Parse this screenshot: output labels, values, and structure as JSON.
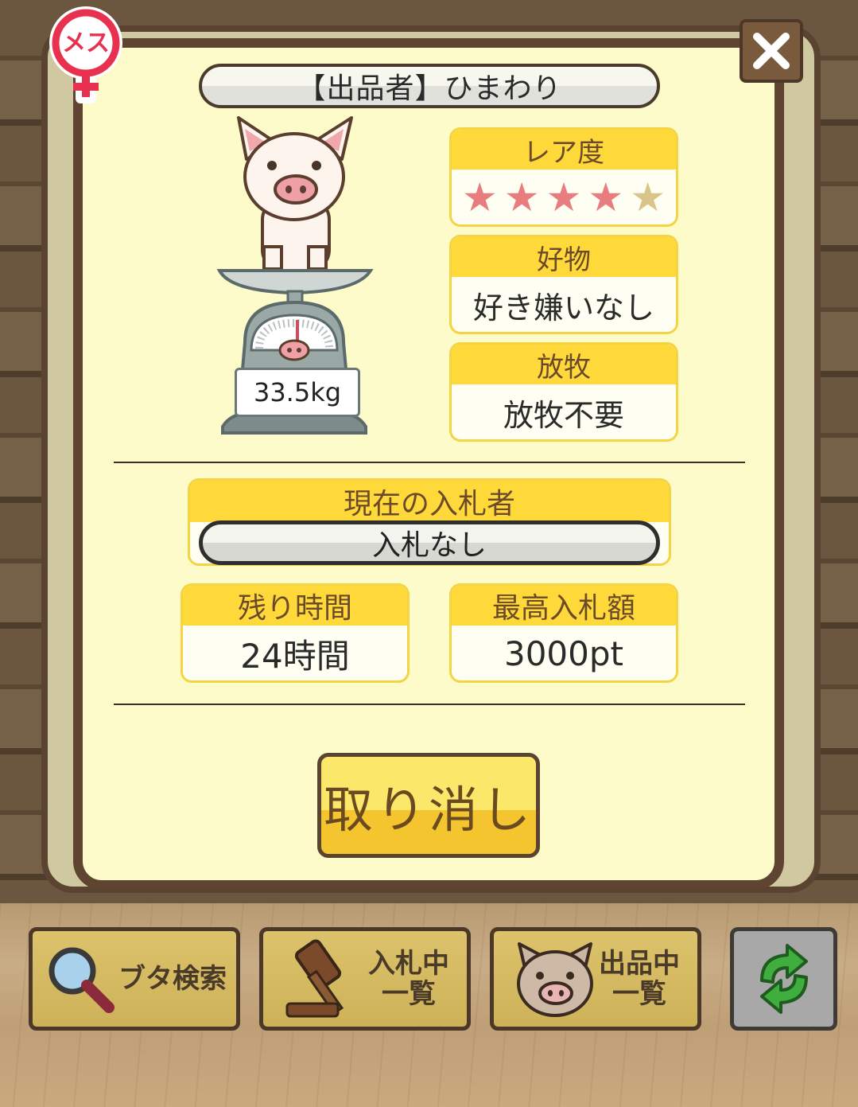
{
  "gender": {
    "label": "メス",
    "color": "#e8314f"
  },
  "seller": {
    "text": "【出品者】ひまわり"
  },
  "pig": {
    "weight": "33.5kg"
  },
  "rarity": {
    "label": "レア度",
    "stars_total": 5,
    "stars_filled": 4,
    "star_color": "#e87d80",
    "star_empty_color": "#d9c58a"
  },
  "favorite": {
    "label": "好物",
    "value": "好き嫌いなし"
  },
  "grazing": {
    "label": "放牧",
    "value": "放牧不要"
  },
  "bidder": {
    "label": "現在の入札者",
    "value": "入札なし"
  },
  "time_left": {
    "label": "残り時間",
    "value": "24時間"
  },
  "max_bid": {
    "label": "最高入札額",
    "value": "3000pt"
  },
  "cancel_button": {
    "label": "取り消し"
  },
  "close_button": {
    "icon": "close-icon"
  },
  "bottom_tabs": [
    {
      "label": "ブタ検索",
      "icon": "magnifier-icon"
    },
    {
      "label_line1": "入札中",
      "label_line2": "一覧",
      "icon": "gavel-icon"
    },
    {
      "label_line1": "出品中",
      "label_line2": "一覧",
      "icon": "pig-face-icon"
    },
    {
      "icon": "refresh-icon"
    }
  ]
}
